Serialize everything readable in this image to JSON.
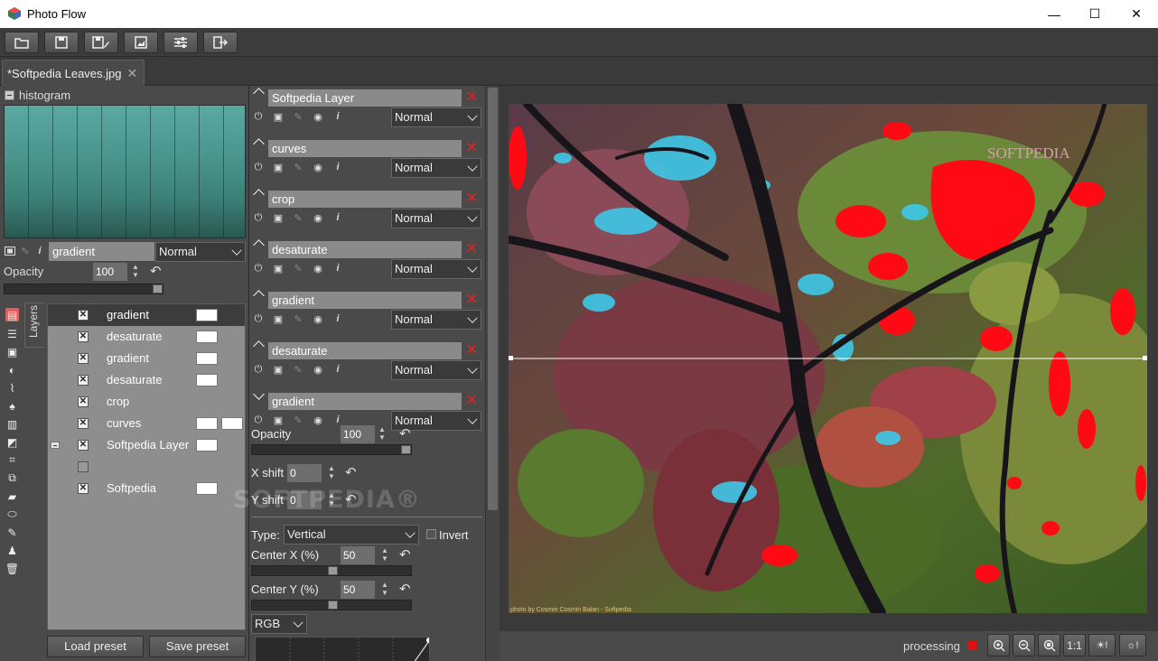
{
  "window": {
    "title": "Photo Flow",
    "controls": {
      "minimize": "—",
      "maximize": "☐",
      "close": "✕"
    }
  },
  "toolbar": {
    "buttons": [
      {
        "icon": "open-folder-icon"
      },
      {
        "icon": "save-icon"
      },
      {
        "icon": "save-as-icon"
      },
      {
        "icon": "export-image-icon"
      },
      {
        "icon": "settings-sliders-icon"
      },
      {
        "icon": "exit-icon"
      }
    ]
  },
  "tab": {
    "label": "*Softpedia Leaves.jpg",
    "close": "✕"
  },
  "histogram": {
    "title": "histogram",
    "color": "#4c9890"
  },
  "active_layer": {
    "name": "gradient",
    "blend_mode": "Normal",
    "opacity_label": "Opacity",
    "opacity_value": "100",
    "opacity_fraction": 1.0
  },
  "layers_tab_label": "Layers",
  "layers": [
    {
      "name": "gradient",
      "checked": true,
      "selected": true,
      "thumbs": 1
    },
    {
      "name": "desaturate",
      "checked": true,
      "thumbs": 1
    },
    {
      "name": "gradient",
      "checked": true,
      "thumbs": 1
    },
    {
      "name": "desaturate",
      "checked": true,
      "thumbs": 1
    },
    {
      "name": "crop",
      "checked": true,
      "thumbs": 0
    },
    {
      "name": "curves",
      "checked": true,
      "thumbs": 2
    },
    {
      "name": "Softpedia Layer",
      "checked": true,
      "expanded": true,
      "thumbs": 1
    },
    {
      "name": "",
      "checked": false,
      "thumbs": 0
    },
    {
      "name": "Softpedia",
      "checked": true,
      "thumbs": 1
    }
  ],
  "preset_buttons": {
    "load": "Load preset",
    "save": "Save preset"
  },
  "filter_stack": [
    {
      "name": "Softpedia Layer",
      "mode": "Normal",
      "collapsed": true
    },
    {
      "name": "curves",
      "mode": "Normal",
      "collapsed": true
    },
    {
      "name": "crop",
      "mode": "Normal",
      "collapsed": true
    },
    {
      "name": "desaturate",
      "mode": "Normal",
      "collapsed": true
    },
    {
      "name": "gradient",
      "mode": "Normal",
      "collapsed": true
    },
    {
      "name": "desaturate",
      "mode": "Normal",
      "collapsed": true
    },
    {
      "name": "gradient",
      "mode": "Normal",
      "collapsed": false
    }
  ],
  "gradient_settings": {
    "opacity_label": "Opacity",
    "opacity_value": "100",
    "opacity_fraction": 1.0,
    "xshift_label": "X shift",
    "xshift_value": "0",
    "yshift_label": "Y shift",
    "yshift_value": "0",
    "type_label": "Type:",
    "type_value": "Vertical",
    "invert_label": "Invert",
    "centerx_label": "Center X (%)",
    "centerx_value": "50",
    "centerx_fraction": 0.5,
    "centery_label": "Center Y (%)",
    "centery_value": "50",
    "centery_fraction": 0.5,
    "channel_value": "RGB"
  },
  "status": {
    "text": "processing",
    "indicator_color": "#e01010",
    "buttons": [
      "zoom-in-icon",
      "zoom-out-icon",
      "zoom-fit-icon",
      "1:1",
      "exposure-warning-icon",
      "highlight-warning-icon"
    ],
    "one_to_one": "1:1"
  },
  "image": {
    "watermark": "SOFTPEDIA",
    "credit": "photo by Cosmin Cosmin Balan - Softpedia"
  },
  "overlay_watermark": "SOFTPEDIA®"
}
